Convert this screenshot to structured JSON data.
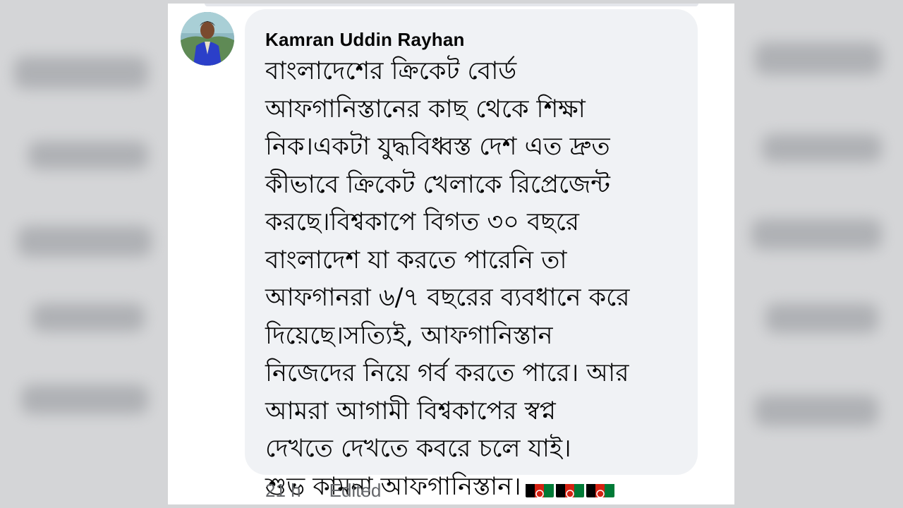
{
  "comment": {
    "author": "Kamran Uddin Rayhan",
    "lines": [
      "বাংলাদেশের ক্রিকেট বোর্ড",
      "আফগানিস্তানের কাছ থেকে শিক্ষা",
      "নিক।একটা যুদ্ধবিধ্বস্ত দেশ এত দ্রুত",
      "কীভাবে ক্রিকেট খেলাকে রিপ্রেজেন্ট",
      "করছে।বিশ্বকাপে বিগত ৩০ বছরে",
      "বাংলাদেশ যা করতে পারেনি তা",
      "আফগানরা ৬/৭ বছরের ব্যবধানে করে",
      "দিয়েছে।সত্যিই, আফগানিস্তান",
      "নিজেদের নিয়ে গর্ব করতে পারে। আর",
      "আমরা আগামী বিশ্বকাপের স্বপ্ন",
      "দেখতে দেখতে কবরে চলে যাই।",
      "শুভ কামনা আফগানিস্তান।"
    ],
    "flag_icons": [
      "afghanistan-flag-icon",
      "afghanistan-flag-icon",
      "afghanistan-flag-icon"
    ],
    "timestamp": "21 h",
    "edited_label": "Edited"
  },
  "colors": {
    "bubble": "#f0f2f5",
    "text": "#050505",
    "meta": "#65676b",
    "flag_black": "#000000",
    "flag_red": "#d32011",
    "flag_green": "#007a36"
  }
}
